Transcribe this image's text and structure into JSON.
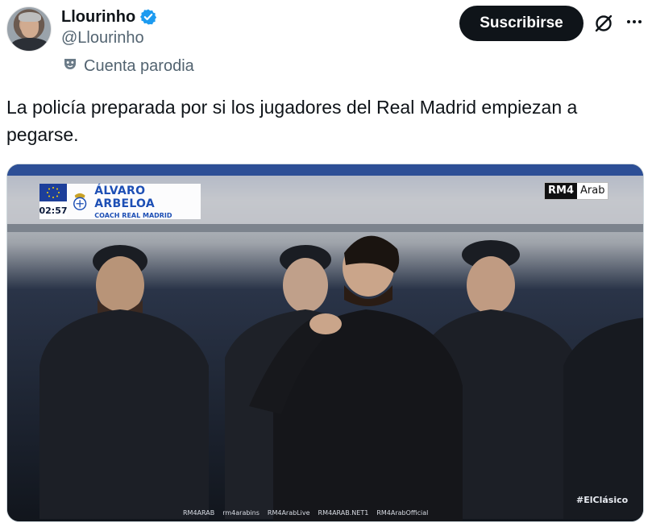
{
  "author": {
    "display_name": "Llourinho",
    "handle": "@Llourinho",
    "verified": true,
    "account_label": "Cuenta parodia"
  },
  "actions": {
    "subscribe_label": "Suscribirse",
    "grok_icon": "grok-slash-icon",
    "more_icon": "more-horizontal-icon"
  },
  "tweet": {
    "text": "La policía preparada por si los jugadores del Real Madrid empiezan a pegarse."
  },
  "media": {
    "lower_third": {
      "clock": "02:57",
      "name": "ÁLVARO ARBELOA",
      "role": "COACH REAL MADRID"
    },
    "broadcaster_a": "RM4",
    "broadcaster_b": "Arab",
    "hashtag": "#ElClásico",
    "socials": [
      "RM4ARAB",
      "rm4arabins",
      "RM4ArabLive",
      "RM4ARAB.NET1",
      "RM4ArabOfficial"
    ]
  },
  "colors": {
    "verified_blue": "#1d9bf0",
    "text_primary": "#0f1419",
    "text_secondary": "#536471",
    "button_bg": "#0f1419"
  }
}
